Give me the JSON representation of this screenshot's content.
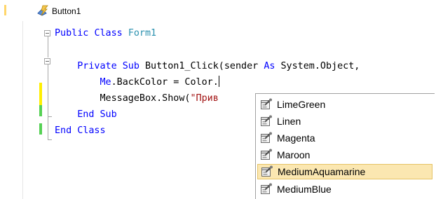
{
  "member_bar": {
    "selected_member": "Button1"
  },
  "code": {
    "l1": {
      "kw1": "Public",
      "sp1": " ",
      "kw2": "Class",
      "sp2": " ",
      "type": "Form1"
    },
    "l3": {
      "indent": "    ",
      "kw1": "Private",
      "sp1": " ",
      "kw2": "Sub",
      "rest": " Button1_Click(sender ",
      "kw3": "As",
      "rest2": " System.Object,"
    },
    "l4": {
      "indent": "        ",
      "kw": "Me",
      "rest": ".BackColor = Color."
    },
    "l5": {
      "indent": "        ",
      "text": "MessageBox.Show(",
      "str": "\"Прив"
    },
    "l6": {
      "indent": "    ",
      "kw1": "End",
      "sp1": " ",
      "kw2": "Sub"
    },
    "l7": {
      "kw1": "End",
      "sp1": " ",
      "kw2": "Class"
    }
  },
  "intellisense": {
    "items": [
      "LimeGreen",
      "Linen",
      "Magenta",
      "Maroon",
      "MediumAquamarine",
      "MediumBlue"
    ],
    "selected": "MediumAquamarine",
    "item_icon": "property-icon"
  },
  "colors": {
    "keyword": "#0000ff",
    "type": "#2b91af",
    "string": "#a31515",
    "selection_bg": "#fbe7b1",
    "change_saved": "#55d154",
    "change_unsaved": "#ffef00"
  }
}
